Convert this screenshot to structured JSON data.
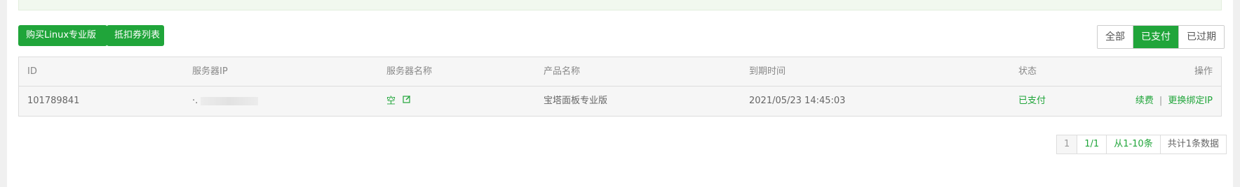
{
  "toolbar": {
    "buy_label": "购买Linux专业版",
    "coupon_label": "抵扣券列表"
  },
  "filter": {
    "all": "全部",
    "paid": "已支付",
    "expired": "已过期"
  },
  "table": {
    "headers": {
      "id": "ID",
      "ip": "服务器IP",
      "name": "服务器名称",
      "product": "产品名称",
      "expire": "到期时间",
      "status": "状态",
      "actions": "操作"
    },
    "rows": [
      {
        "id": "101789841",
        "ip_prefix": "·.",
        "name": "空",
        "product": "宝塔面板专业版",
        "expire": "2021/05/23 14:45:03",
        "status": "已支付",
        "renew": "续费",
        "separator": "|",
        "rebind": "更换绑定IP"
      }
    ]
  },
  "pagination": {
    "current": "1",
    "pages": "1/1",
    "range": "从1-10条",
    "total": "共计1条数据"
  },
  "colors": {
    "accent": "#20a53a"
  }
}
